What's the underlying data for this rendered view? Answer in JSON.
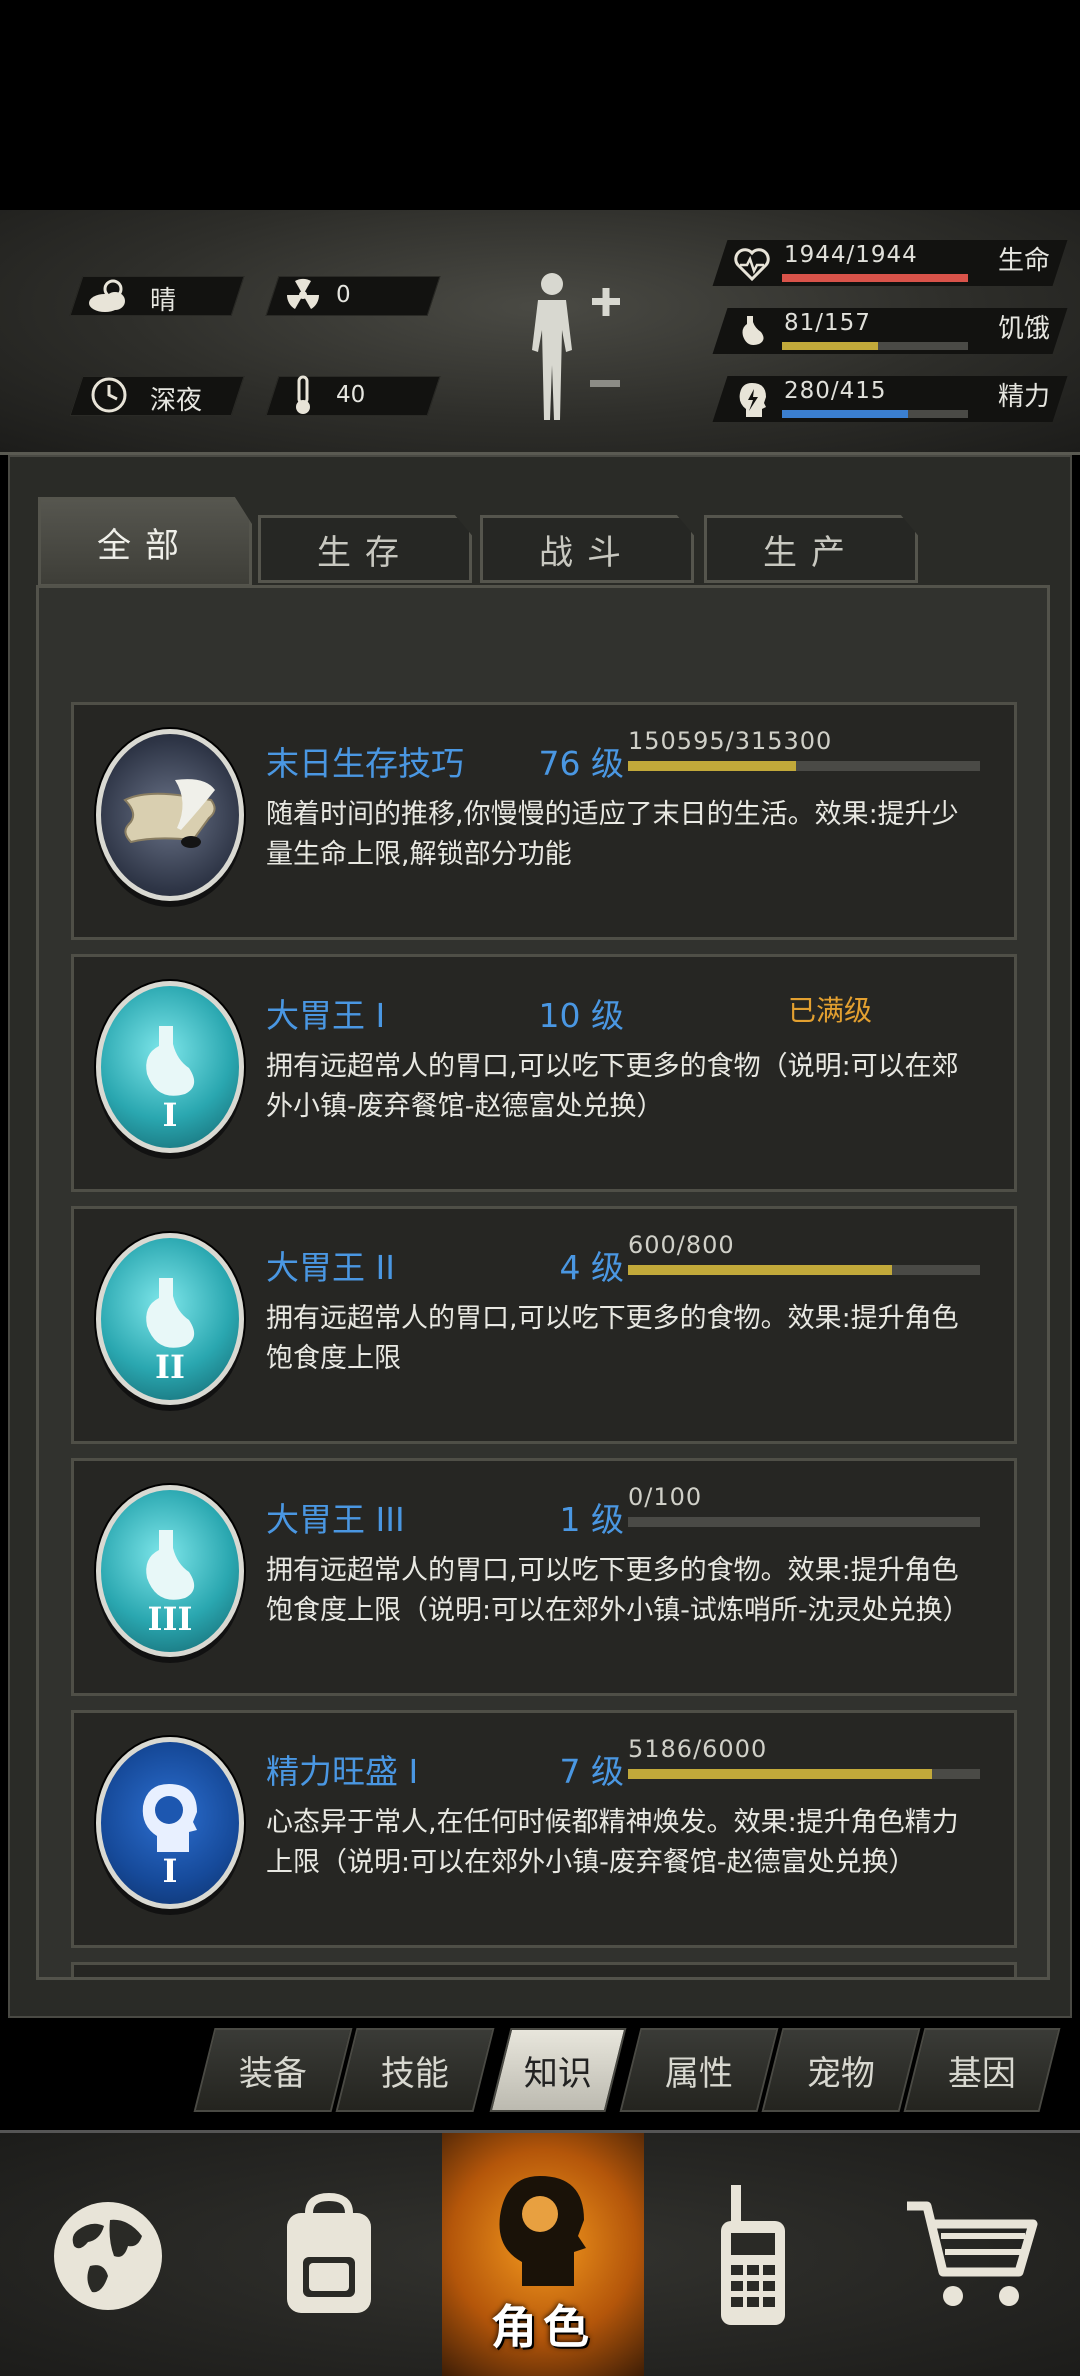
{
  "environment": {
    "weather": "晴",
    "radiation": "0",
    "time_of_day": "深夜",
    "temperature": "40"
  },
  "stats": [
    {
      "name": "生命",
      "value": "1944/1944",
      "fraction": 1.0,
      "color": "#d9534a",
      "icon": "heart-pulse-icon"
    },
    {
      "name": "饥饿",
      "value": "81/157",
      "fraction": 0.516,
      "color": "#c2a93a",
      "icon": "stomach-icon"
    },
    {
      "name": "精力",
      "value": "280/415",
      "fraction": 0.675,
      "color": "#3b7fd0",
      "icon": "head-bolt-icon"
    }
  ],
  "tabs": [
    {
      "label": "全部",
      "active": true
    },
    {
      "label": "生存",
      "active": false
    },
    {
      "label": "战斗",
      "active": false
    },
    {
      "label": "生产",
      "active": false
    }
  ],
  "skills": [
    {
      "name": "末日生存技巧",
      "level": "76 级",
      "progress": "150595/315300",
      "fraction": 0.4776,
      "maxed": false,
      "max_label": "",
      "desc": "随着时间的推移,你慢慢的适应了末日的生活。效果:提升少量生命上限,解锁部分功能",
      "icon": "scroll-quill-icon",
      "numeral": ""
    },
    {
      "name": "大胃王 I",
      "level": "10 级",
      "progress": "",
      "fraction": 1.0,
      "maxed": true,
      "max_label": "已满级",
      "desc": "拥有远超常人的胃口,可以吃下更多的食物（说明:可以在郊外小镇-废弃餐馆-赵德富处兑换）",
      "icon": "stomach-icon",
      "numeral": "I"
    },
    {
      "name": "大胃王 II",
      "level": "4 级",
      "progress": "600/800",
      "fraction": 0.75,
      "maxed": false,
      "max_label": "",
      "desc": "拥有远超常人的胃口,可以吃下更多的食物。效果:提升角色饱食度上限",
      "icon": "stomach-icon",
      "numeral": "II"
    },
    {
      "name": "大胃王 III",
      "level": "1 级",
      "progress": "0/100",
      "fraction": 0.0,
      "maxed": false,
      "max_label": "",
      "desc": "拥有远超常人的胃口,可以吃下更多的食物。效果:提升角色饱食度上限（说明:可以在郊外小镇-试炼哨所-沈灵处兑换）",
      "icon": "stomach-icon",
      "numeral": "III"
    },
    {
      "name": "精力旺盛 I",
      "level": "7 级",
      "progress": "5186/6000",
      "fraction": 0.864,
      "maxed": false,
      "max_label": "",
      "desc": "心态异于常人,在任何时候都精神焕发。效果:提升角色精力上限（说明:可以在郊外小镇-废弃餐馆-赵德富处兑换）",
      "icon": "head-silhouette-icon",
      "numeral": "I"
    }
  ],
  "subtabs": [
    {
      "label": "装备",
      "active": false
    },
    {
      "label": "技能",
      "active": false
    },
    {
      "label": "知识",
      "active": true
    },
    {
      "label": "属性",
      "active": false
    },
    {
      "label": "宠物",
      "active": false
    },
    {
      "label": "基因",
      "active": false
    }
  ],
  "bottom_nav": [
    {
      "icon": "globe-icon",
      "label": ""
    },
    {
      "icon": "backpack-icon",
      "label": ""
    },
    {
      "icon": "character-head-icon",
      "label": "角色",
      "active": true
    },
    {
      "icon": "walkie-talkie-icon",
      "label": ""
    },
    {
      "icon": "shopping-cart-icon",
      "label": ""
    }
  ]
}
